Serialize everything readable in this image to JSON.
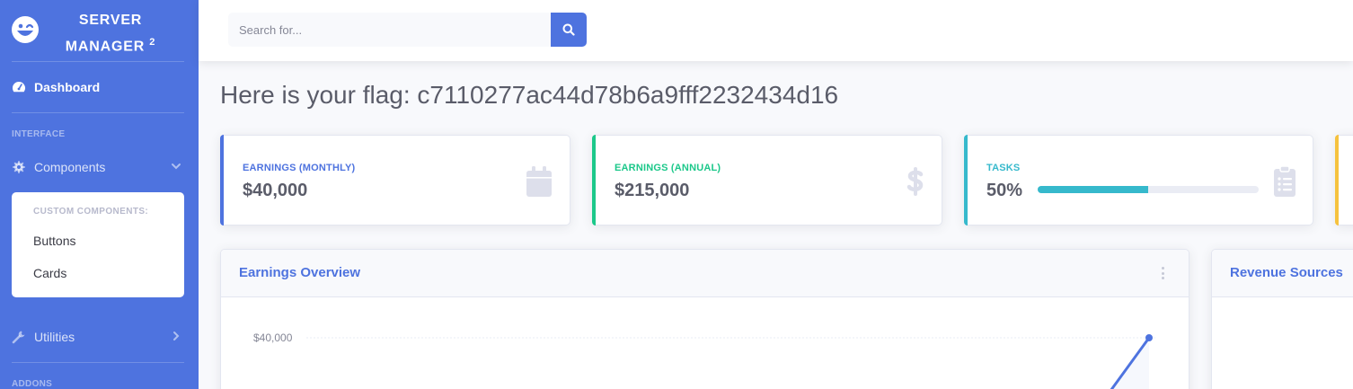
{
  "sidebar": {
    "brand": {
      "line1": "SERVER",
      "line2": "MANAGER",
      "sup": "2",
      "icon": "laugh-wink-icon"
    },
    "dashboard": {
      "label": "Dashboard",
      "icon": "tachometer-icon"
    },
    "heading_interface": "INTERFACE",
    "components": {
      "label": "Components",
      "icon": "cog-icon",
      "chevron": "chevron-down-icon"
    },
    "collapse": {
      "header": "CUSTOM COMPONENTS:",
      "items": [
        {
          "label": "Buttons"
        },
        {
          "label": "Cards"
        }
      ]
    },
    "utilities": {
      "label": "Utilities",
      "icon": "wrench-icon",
      "chevron": "chevron-right-icon"
    },
    "heading_addons": "ADDONS"
  },
  "topbar": {
    "search": {
      "placeholder": "Search for...",
      "value": ""
    },
    "search_button_icon": "search-icon"
  },
  "main": {
    "title": "Here is your flag: c7110277ac44d78b6a9fff2232434d16",
    "cards": [
      {
        "label": "EARNINGS (MONTHLY)",
        "value": "$40,000",
        "color": "#4e73df",
        "icon": "calendar-icon"
      },
      {
        "label": "EARNINGS (ANNUAL)",
        "value": "$215,000",
        "color": "#1cc88a",
        "icon": "dollar-icon"
      },
      {
        "label": "TASKS",
        "value": "50%",
        "progress": 0.5,
        "color": "#36b9cc",
        "icon": "clipboard-list-icon"
      },
      {
        "color": "#f6c23e"
      }
    ],
    "earnings_panel": {
      "title": "Earnings Overview",
      "y_tick": "$40,000"
    },
    "revenue_panel": {
      "title": "Revenue Sources"
    }
  },
  "colors": {
    "primary": "#4e73df",
    "success": "#1cc88a",
    "info": "#36b9cc",
    "warning": "#f6c23e",
    "text": "#5a5c69"
  }
}
